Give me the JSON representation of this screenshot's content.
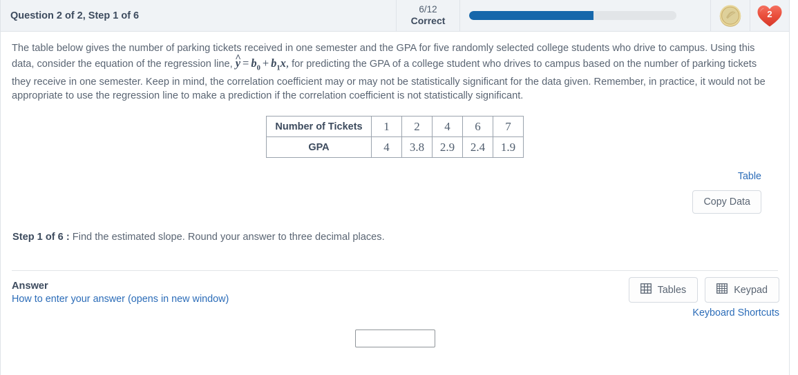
{
  "header": {
    "title": "Question 2 of 2, Step 1 of 6",
    "score_fraction": "6/12",
    "score_label": "Correct",
    "progress_percent": 60,
    "coin_icon": "coin-icon",
    "hearts_count": "2",
    "accent_color": "#1667ab",
    "heart_color": "#e8493a",
    "coin_color": "#e3d08a"
  },
  "question": {
    "text_part1": "The table below gives the number of parking tickets received in one semester and the GPA for five randomly selected college students who drive to campus. Using this data, consider the equation of the regression line,",
    "equation": {
      "lhs": "y",
      "hat": "^",
      "equals": "=",
      "b0": "b",
      "b0_sub": "0",
      "plus": "+",
      "b1": "b",
      "b1_sub": "1",
      "x": "x",
      "trailing": ","
    },
    "text_part2": "for predicting the GPA of a college student who drives to campus based on the number of parking tickets they receive in one semester. Keep in mind, the correlation coefficient may or may not be statistically significant for the data given. Remember, in practice, it would not be appropriate to use the regression line to make a prediction if the correlation coefficient is not statistically significant."
  },
  "data_table": {
    "row_labels": [
      "Number of Tickets",
      "GPA"
    ],
    "tickets": [
      "1",
      "2",
      "4",
      "6",
      "7"
    ],
    "gpa": [
      "4",
      "3.8",
      "2.9",
      "2.4",
      "1.9"
    ]
  },
  "actions": {
    "table_link": "Table",
    "copy_data": "Copy Data"
  },
  "step": {
    "label": "Step 1 of 6 :",
    "instruction": "Find the estimated slope. Round your answer to three decimal places."
  },
  "answer": {
    "title": "Answer",
    "help_link": "How to enter your answer (opens in new window)",
    "tables_button": "Tables",
    "keypad_button": "Keypad",
    "keyboard_shortcuts": "Keyboard Shortcuts",
    "input_value": "",
    "input_placeholder": ""
  }
}
